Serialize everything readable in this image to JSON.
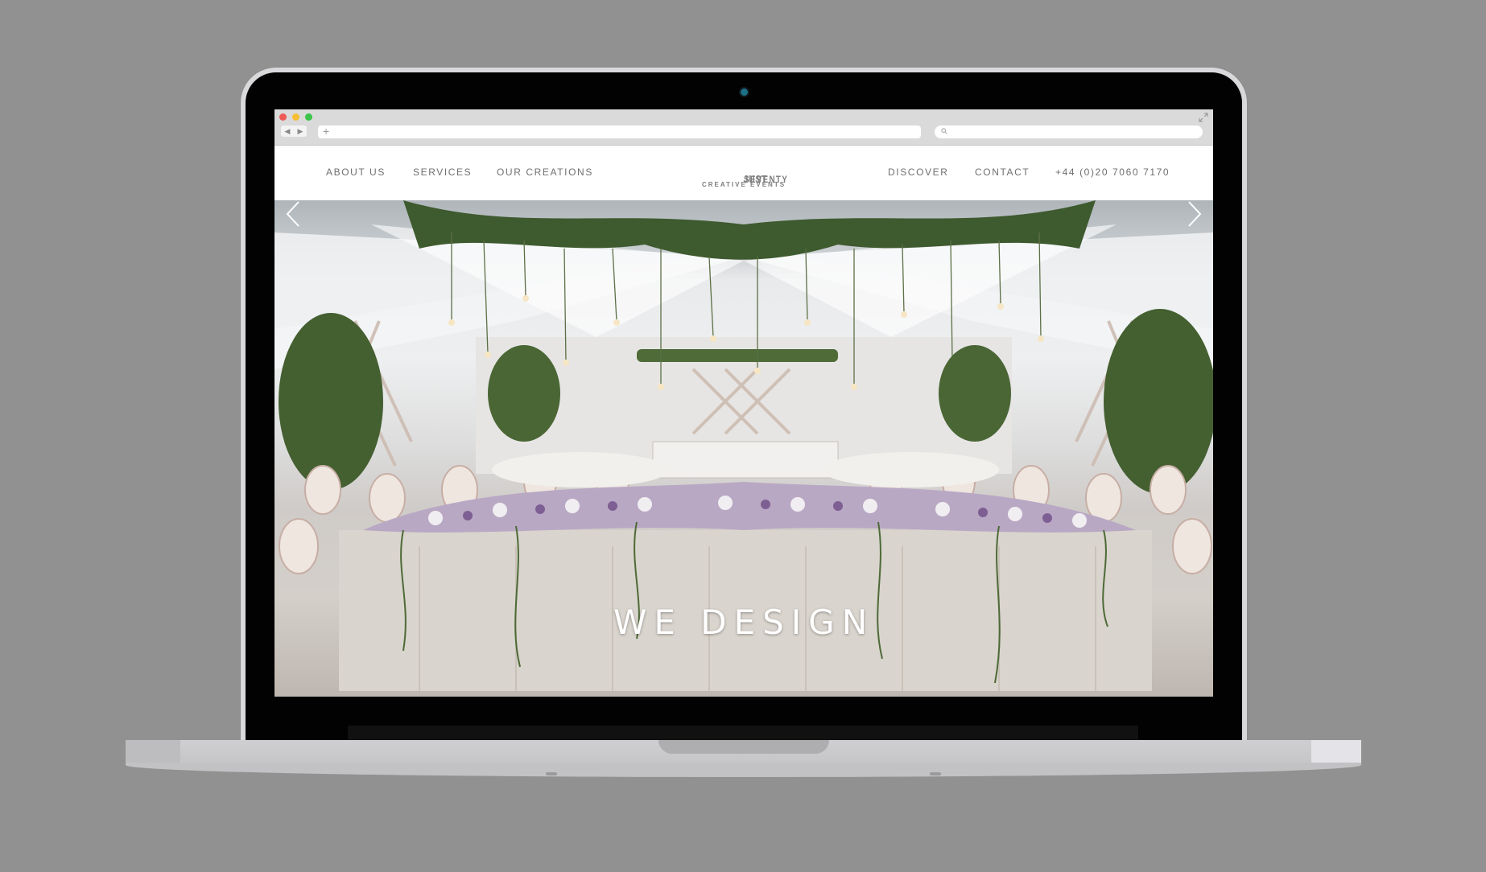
{
  "site": {
    "nav_left": [
      "ABOUT US",
      "SERVICES",
      "OUR CREATIONS"
    ],
    "nav_right": [
      "DISCOVER",
      "CONTACT",
      "+44 (0)20 7060 7170"
    ],
    "logo": {
      "light": "JUST",
      "bold": "SEVENTY",
      "tagline": "CREATIVE EVENTS"
    }
  },
  "hero": {
    "title": "WE DESIGN"
  },
  "colors": {
    "background": "#919191",
    "nav_text": "#6f6f6f",
    "logo": "#7d7d7d"
  },
  "icons": [
    "back-icon",
    "forward-icon",
    "plus-icon",
    "search-icon",
    "expand-icon",
    "chevron-left-icon",
    "chevron-right-icon",
    "camera-icon"
  ]
}
